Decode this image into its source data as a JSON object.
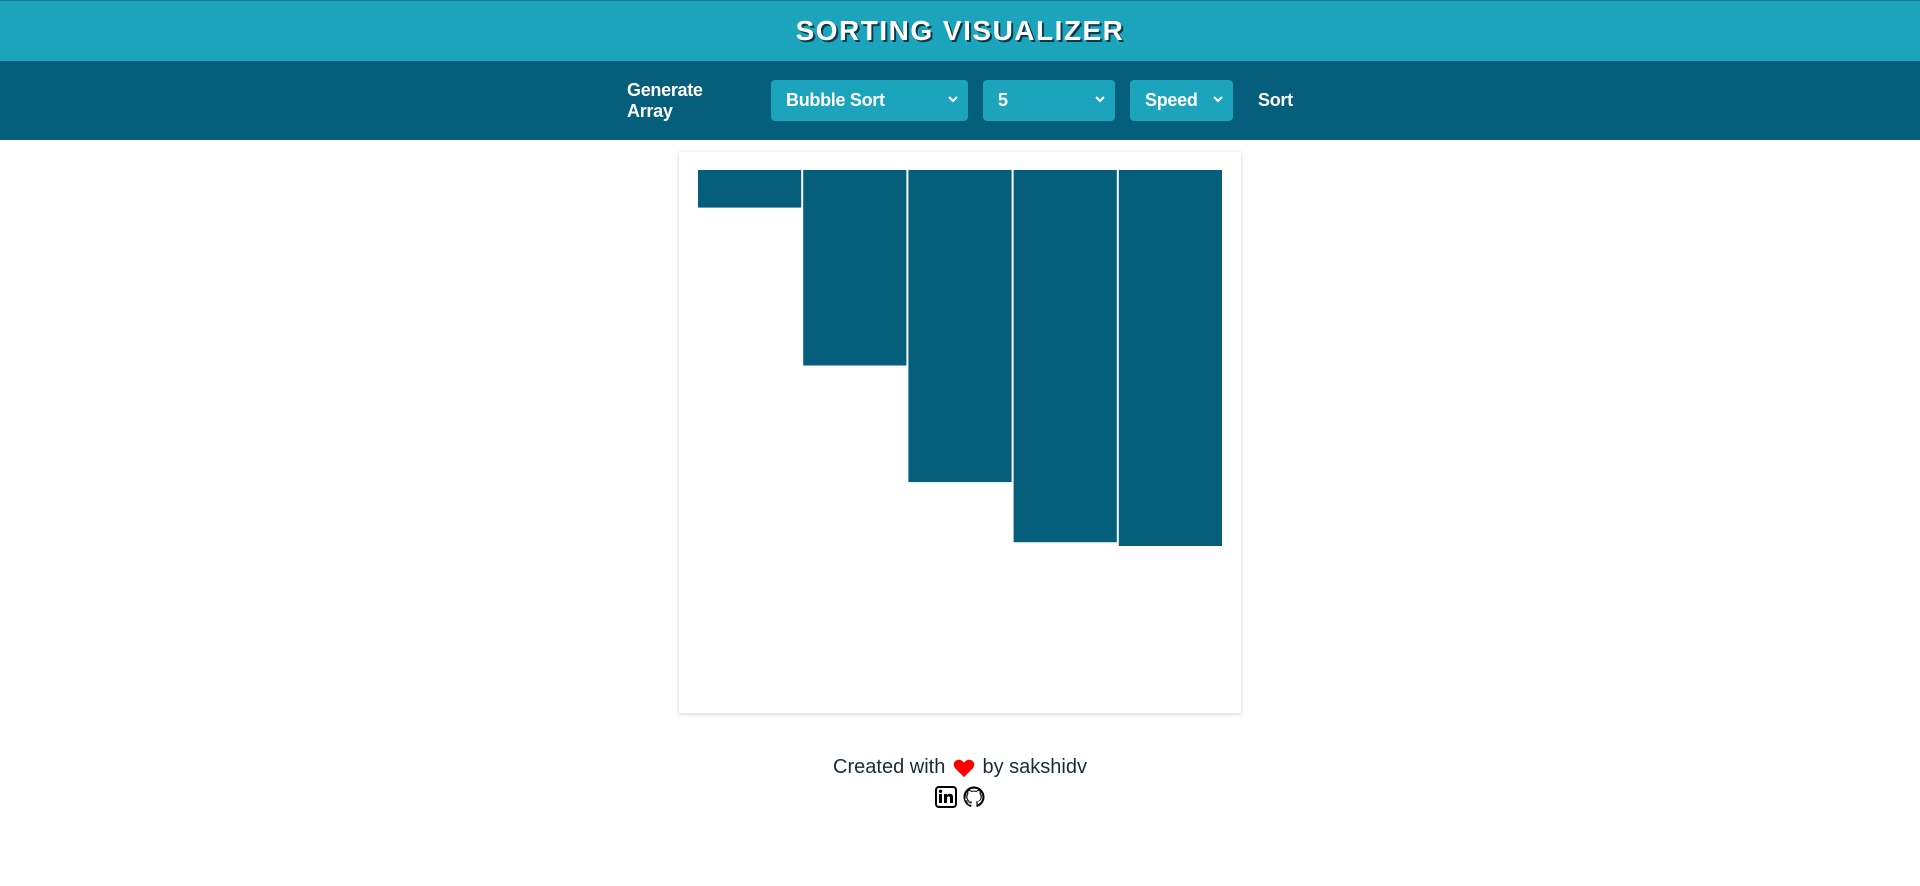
{
  "header": {
    "title": "SORTING VISUALIZER",
    "background": "#1ba4bc"
  },
  "toolbar": {
    "background": "#055e7c",
    "generate_label": "Generate Array",
    "algorithm_select": {
      "value": "Bubble Sort"
    },
    "size_select": {
      "value": "5"
    },
    "speed_select": {
      "value": "Speed"
    },
    "sort_label": "Sort",
    "select_color": "#1ba4bc"
  },
  "chart_data": {
    "type": "bar",
    "values": [
      10,
      52,
      83,
      99,
      100
    ],
    "bar_color": "#055e7c",
    "orientation": "hanging-from-top"
  },
  "footer": {
    "created_with": "Created with",
    "by_text": "by sakshidv",
    "heart_icon": "heart-icon",
    "heart_color": "#ff0000",
    "social_icons": [
      "linkedin-icon",
      "github-icon"
    ]
  }
}
